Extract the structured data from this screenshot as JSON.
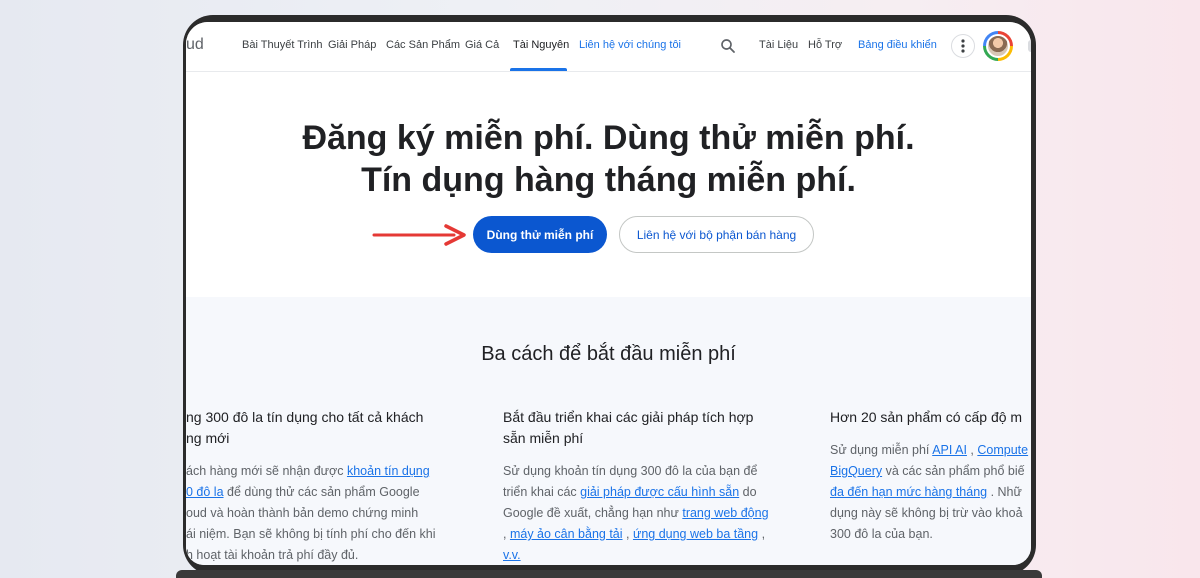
{
  "header": {
    "logo_fragment": "ud",
    "nav": [
      "Bài Thuyết Trình",
      "Giải Pháp",
      "Các Sản Phẩm",
      "Giá Cả",
      "Tài Nguyên"
    ],
    "contact_link": "Liên hệ với chúng tôi",
    "docs": "Tài Liệu",
    "support": "Hỗ Trợ",
    "console": "Bảng điều khiển",
    "active_tab": "Tài Nguyên"
  },
  "hero": {
    "line1": "Đăng ký miễn phí. Dùng thử miễn phí.",
    "line2": "Tín dụng hàng tháng miễn phí.",
    "primary_button": "Dùng thử miễn phí",
    "secondary_button": "Liên hệ với bộ phận bán hàng"
  },
  "section": {
    "title": "Ba cách để bắt đầu miễn phí",
    "columns": [
      {
        "title_lines": [
          "ng 300 đô la tín dụng cho tất cả khách",
          "ng mới"
        ],
        "body": {
          "l1_text": "ách hàng mới sẽ nhận được ",
          "l1_link": "khoản tín dụng",
          "l2_link": "0 đô la",
          "l2_text": " để dùng thử các sản phẩm Google",
          "l3_text": "oud và hoàn thành bản demo chứng minh",
          "l4_text": "ái niệm. Bạn sẽ không bị tính phí cho đến khi",
          "l5_text": "h hoạt tài khoản trả phí đầy đủ."
        }
      },
      {
        "title_lines": [
          "Bắt đầu triển khai các giải pháp tích hợp",
          "sẵn miễn phí"
        ],
        "body": {
          "l1_text": "Sử dụng khoản tín dụng 300 đô la của bạn để",
          "l2_text": "triển khai các ",
          "l2_link": "giải pháp được cấu hình sẵn",
          "l2_tail": " do",
          "l3_text": "Google đề xuất, chẳng hạn như ",
          "l3_link": "trang web động",
          "l4_pre": ", ",
          "l4_link1": "máy ảo cân bằng tải",
          "l4_mid": " , ",
          "l4_link2": "ứng dụng web ba tầng",
          "l4_tail": " ,",
          "l5_link": "v.v."
        }
      },
      {
        "title_lines": [
          "Hơn 20 sản phẩm có cấp độ m"
        ],
        "body": {
          "l1_text": "Sử dụng miễn phí ",
          "l1_link1": "API AI",
          "l1_mid": " , ",
          "l1_link2": "Compute",
          "l2_link": "BigQuery",
          "l2_text": " và các sản phẩm phổ biế",
          "l3_link": "đa đến hạn mức hàng tháng",
          "l3_text": " . Nhữ",
          "l4_text": "dụng này sẽ không bị trừ vào khoả",
          "l5_text": "300 đô la của bạn."
        }
      }
    ]
  },
  "colors": {
    "primary": "#0b57d0",
    "link": "#1a73e8",
    "arrow": "#e53935"
  },
  "icons": {
    "search": "search-icon",
    "more": "more-vert-icon",
    "arrow": "arrow-right-icon"
  }
}
